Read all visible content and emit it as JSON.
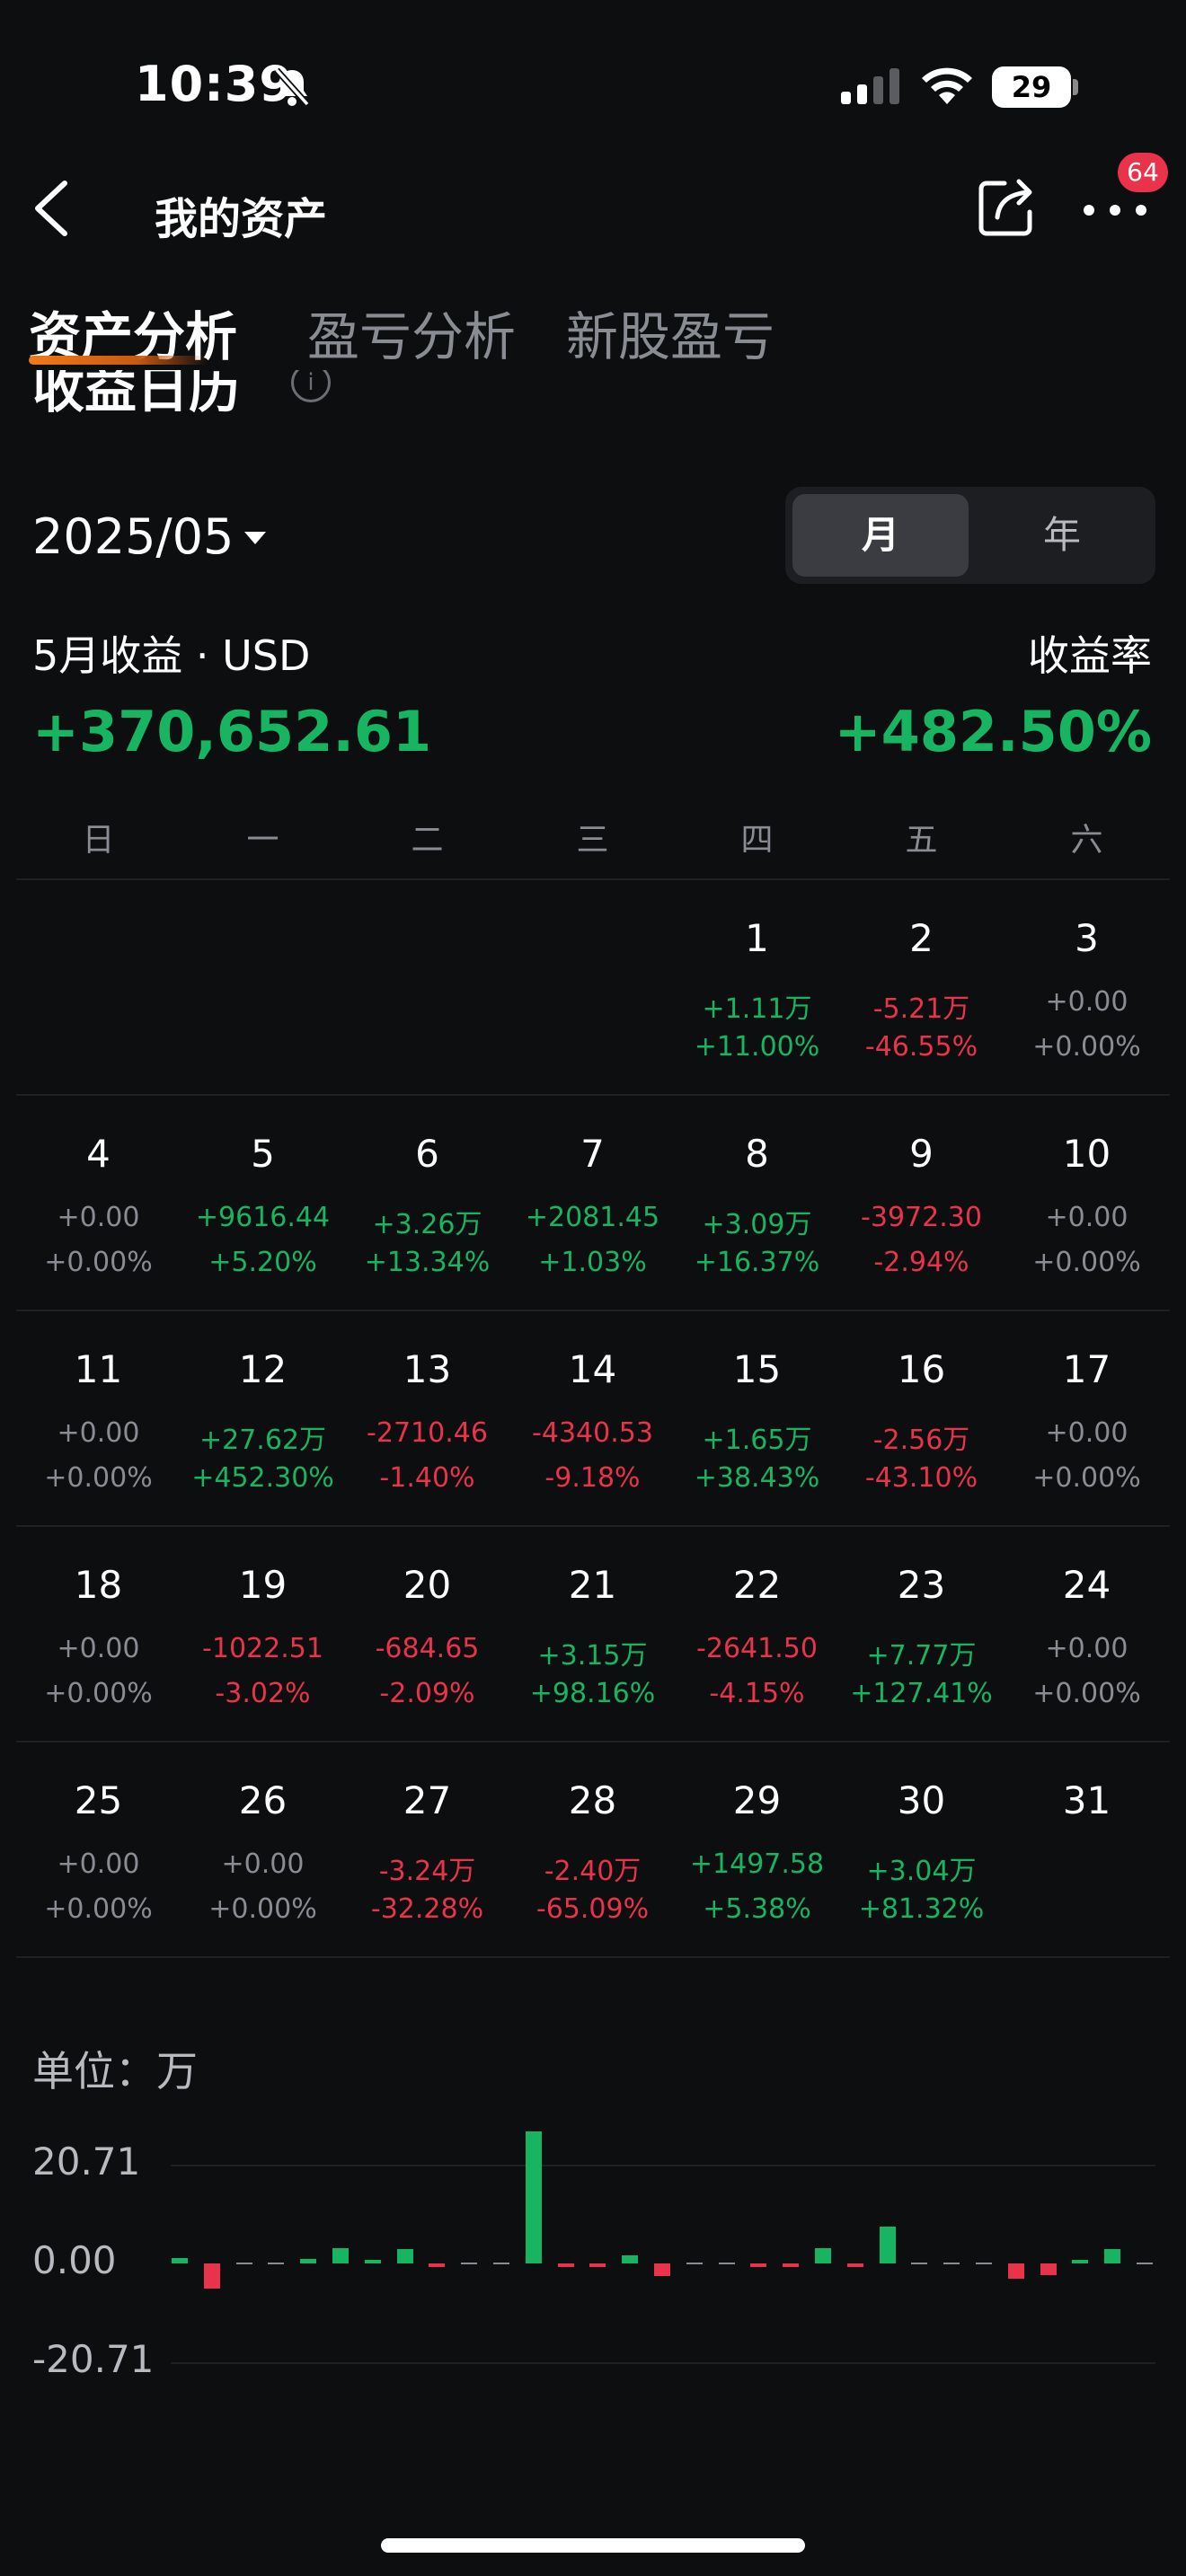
{
  "status_bar": {
    "time": "10:39",
    "battery": "29"
  },
  "nav": {
    "title": "我的资产",
    "badge": "64"
  },
  "tabs": [
    "资产分析",
    "盈亏分析",
    "新股盈亏"
  ],
  "section_title": "收益日历",
  "month": "2025/05",
  "toggle": {
    "month": "月",
    "year": "年"
  },
  "summary": {
    "label": "5月收益 · USD",
    "rate_label": "收益率",
    "value": "+370,652.61",
    "rate": "+482.50%"
  },
  "colors": {
    "green": "#17b561",
    "red": "#e8334a",
    "neutral": "#8a8c93"
  },
  "weekdays": [
    "日",
    "一",
    "二",
    "三",
    "四",
    "五",
    "六"
  ],
  "days": [
    {
      "day": "1",
      "value": "+1.11万",
      "pct": "+11.00%",
      "trend": "up"
    },
    {
      "day": "2",
      "value": "-5.21万",
      "pct": "-46.55%",
      "trend": "down"
    },
    {
      "day": "3",
      "value": "+0.00",
      "pct": "+0.00%",
      "trend": "flat"
    },
    {
      "day": "4",
      "value": "+0.00",
      "pct": "+0.00%",
      "trend": "flat"
    },
    {
      "day": "5",
      "value": "+9616.44",
      "pct": "+5.20%",
      "trend": "up"
    },
    {
      "day": "6",
      "value": "+3.26万",
      "pct": "+13.34%",
      "trend": "up"
    },
    {
      "day": "7",
      "value": "+2081.45",
      "pct": "+1.03%",
      "trend": "up"
    },
    {
      "day": "8",
      "value": "+3.09万",
      "pct": "+16.37%",
      "trend": "up"
    },
    {
      "day": "9",
      "value": "-3972.30",
      "pct": "-2.94%",
      "trend": "down"
    },
    {
      "day": "10",
      "value": "+0.00",
      "pct": "+0.00%",
      "trend": "flat"
    },
    {
      "day": "11",
      "value": "+0.00",
      "pct": "+0.00%",
      "trend": "flat"
    },
    {
      "day": "12",
      "value": "+27.62万",
      "pct": "+452.30%",
      "trend": "up"
    },
    {
      "day": "13",
      "value": "-2710.46",
      "pct": "-1.40%",
      "trend": "down"
    },
    {
      "day": "14",
      "value": "-4340.53",
      "pct": "-9.18%",
      "trend": "down"
    },
    {
      "day": "15",
      "value": "+1.65万",
      "pct": "+38.43%",
      "trend": "up"
    },
    {
      "day": "16",
      "value": "-2.56万",
      "pct": "-43.10%",
      "trend": "down"
    },
    {
      "day": "17",
      "value": "+0.00",
      "pct": "+0.00%",
      "trend": "flat"
    },
    {
      "day": "18",
      "value": "+0.00",
      "pct": "+0.00%",
      "trend": "flat"
    },
    {
      "day": "19",
      "value": "-1022.51",
      "pct": "-3.02%",
      "trend": "down"
    },
    {
      "day": "20",
      "value": "-684.65",
      "pct": "-2.09%",
      "trend": "down"
    },
    {
      "day": "21",
      "value": "+3.15万",
      "pct": "+98.16%",
      "trend": "up"
    },
    {
      "day": "22",
      "value": "-2641.50",
      "pct": "-4.15%",
      "trend": "down"
    },
    {
      "day": "23",
      "value": "+7.77万",
      "pct": "+127.41%",
      "trend": "up"
    },
    {
      "day": "24",
      "value": "+0.00",
      "pct": "+0.00%",
      "trend": "flat"
    },
    {
      "day": "25",
      "value": "+0.00",
      "pct": "+0.00%",
      "trend": "flat"
    },
    {
      "day": "26",
      "value": "+0.00",
      "pct": "+0.00%",
      "trend": "flat"
    },
    {
      "day": "27",
      "value": "-3.24万",
      "pct": "-32.28%",
      "trend": "down"
    },
    {
      "day": "28",
      "value": "-2.40万",
      "pct": "-65.09%",
      "trend": "down"
    },
    {
      "day": "29",
      "value": "+1497.58",
      "pct": "+5.38%",
      "trend": "up"
    },
    {
      "day": "30",
      "value": "+3.04万",
      "pct": "+81.32%",
      "trend": "up"
    },
    {
      "day": "31",
      "value": "",
      "pct": "",
      "trend": "none"
    }
  ],
  "chart_data": {
    "type": "bar",
    "ylabel": "单位：万",
    "yticks": [
      "20.71",
      "0.00",
      "-20.71"
    ],
    "ylim": [
      -20.71,
      20.71
    ],
    "categories": [
      "1",
      "2",
      "3",
      "4",
      "5",
      "6",
      "7",
      "8",
      "9",
      "10",
      "11",
      "12",
      "13",
      "14",
      "15",
      "16",
      "17",
      "18",
      "19",
      "20",
      "21",
      "22",
      "23",
      "24",
      "25",
      "26",
      "27",
      "28",
      "29",
      "30",
      "31"
    ],
    "values": [
      1.11,
      -5.21,
      0,
      0,
      0.96,
      3.26,
      0.21,
      3.09,
      -0.4,
      0,
      0,
      27.62,
      -0.27,
      -0.43,
      1.65,
      -2.56,
      0,
      0,
      -0.1,
      -0.07,
      3.15,
      -0.26,
      7.77,
      0,
      0,
      0,
      -3.24,
      -2.4,
      0.15,
      3.04,
      0
    ]
  }
}
